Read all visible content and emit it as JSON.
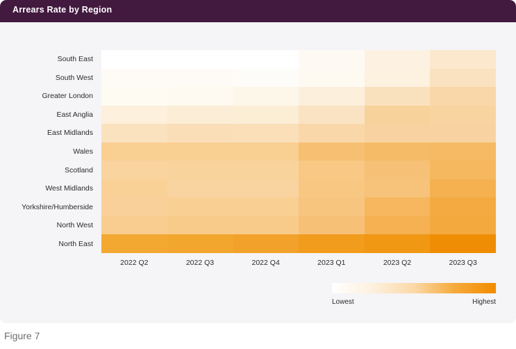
{
  "header": {
    "title": "Arrears Rate by Region"
  },
  "caption": {
    "text": "Figure 7"
  },
  "legend": {
    "low_label": "Lowest",
    "high_label": "Highest",
    "gradient_start": "#ffffff",
    "gradient_end": "#f28c00"
  },
  "colors": {
    "card_background": "#f5f4f6",
    "page_background": "#ffffff",
    "header_bar": "#42193f",
    "header_text": "#ffffff",
    "axis_text": "#2b2b2b",
    "caption_text": "#6f6f6f"
  },
  "chart_data": {
    "type": "heatmap",
    "title": "Arrears Rate by Region",
    "xlabel": "",
    "ylabel": "",
    "grid": false,
    "legend_position": "bottom-right",
    "colorscale": [
      "#ffffff",
      "#fdf0de",
      "#fbd9a8",
      "#f6a93a",
      "#f28c00"
    ],
    "colorbar_ticklabels": [
      "Lowest",
      "Highest"
    ],
    "categories": [
      "2022 Q2",
      "2022 Q3",
      "2022 Q4",
      "2023 Q1",
      "2023 Q2",
      "2023 Q3"
    ],
    "rows": [
      "South East",
      "South West",
      "Greater London",
      "East Anglia",
      "East Midlands",
      "Wales",
      "Scotland",
      "West Midlands",
      "Yorkshire/Humberside",
      "North West",
      "North East"
    ],
    "cell_colors": [
      [
        "#ffffff",
        "#ffffff",
        "#ffffff",
        "#fefaf3",
        "#fdf2e2",
        "#fbe8cd"
      ],
      [
        "#fefbf6",
        "#fefbf6",
        "#fefcf8",
        "#fefaf2",
        "#fdf1df",
        "#fae2c0"
      ],
      [
        "#fefbf3",
        "#fefaf1",
        "#fdf7ea",
        "#fcefdc",
        "#fae1bd",
        "#f9d7a9"
      ],
      [
        "#fdf0dc",
        "#fcedd6",
        "#fcedd5",
        "#fae3c2",
        "#f8d29b",
        "#f8d5a0"
      ],
      [
        "#fbe2bf",
        "#fadeb7",
        "#fadfb8",
        "#f9d7a9",
        "#f8d2a0",
        "#f8d3a1"
      ],
      [
        "#f9cf92",
        "#f9cf92",
        "#f9cf92",
        "#f7bf72",
        "#f6bb66",
        "#f6ba64"
      ],
      [
        "#f9d49f",
        "#f9d39c",
        "#f9d39c",
        "#f8c884",
        "#f7c077",
        "#f6b85f"
      ],
      [
        "#f9d096",
        "#f9d4a0",
        "#f9d4a0",
        "#f8c782",
        "#f7c27a",
        "#f5b14f"
      ],
      [
        "#f9d09a",
        "#f9cf94",
        "#f9cf94",
        "#f7c57e",
        "#f6b75e",
        "#f4aa41"
      ],
      [
        "#f9cd8f",
        "#f8cb8a",
        "#f8cb8a",
        "#f7c077",
        "#f5b152",
        "#f4a93f"
      ],
      [
        "#f3a832",
        "#f3a62d",
        "#f2a22a",
        "#f29c1d",
        "#f09714",
        "#ef8d04"
      ]
    ],
    "values_note": "Arrears rate intensity, lowest (white) to highest (orange)"
  }
}
